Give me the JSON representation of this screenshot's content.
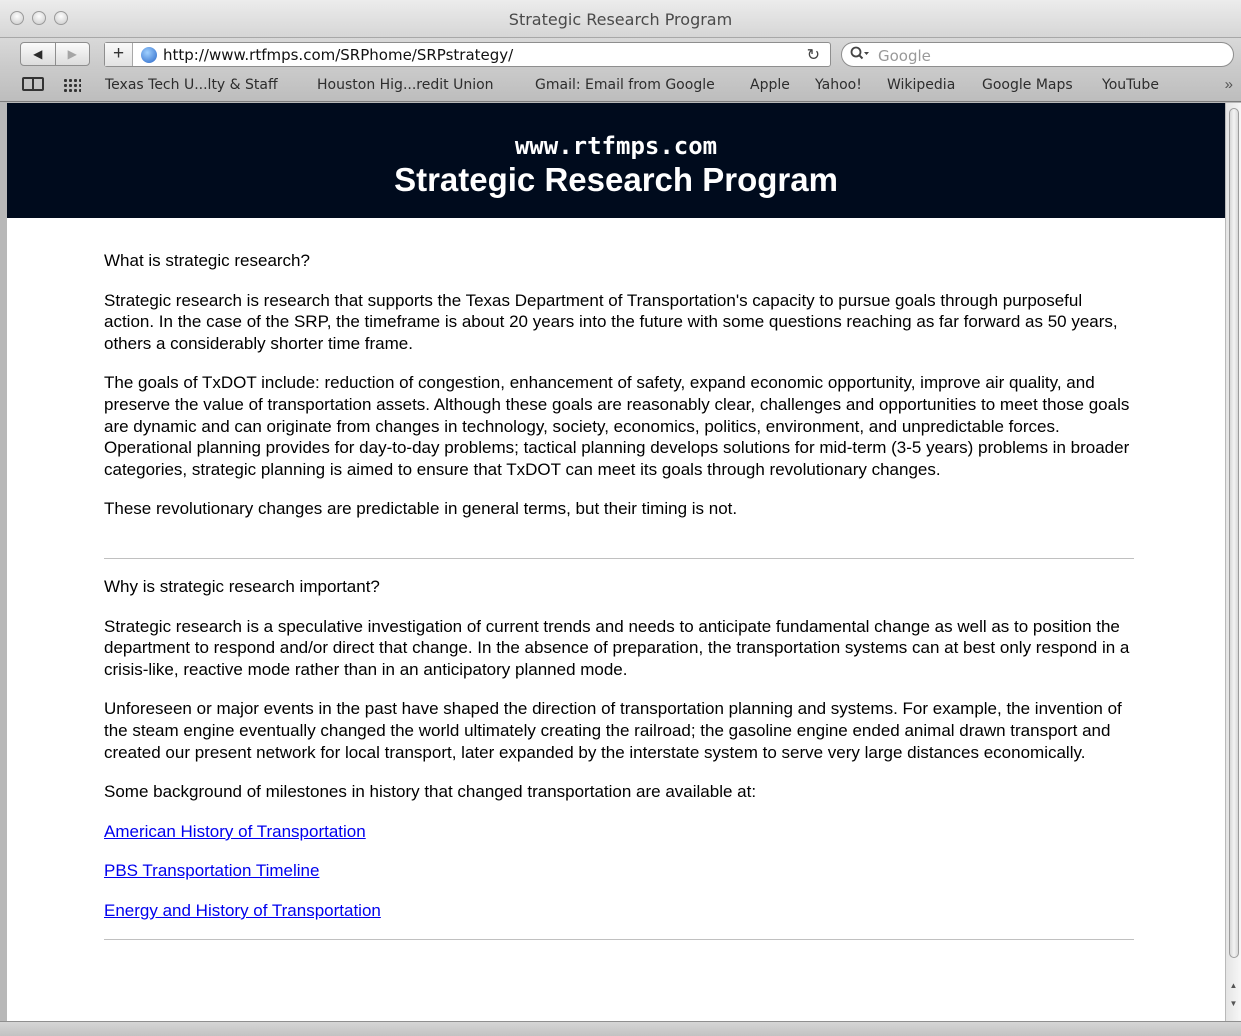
{
  "window": {
    "title": "Strategic Research Program"
  },
  "toolbar": {
    "back": "◀",
    "forward": "▶",
    "add": "+",
    "url": "http://www.rtfmps.com/SRPhome/SRPstrategy/",
    "reload": "↻",
    "search_placeholder": "Google"
  },
  "bookmarks": [
    "Texas Tech U...lty & Staff",
    "Houston Hig...redit Union",
    "Gmail: Email from Google",
    "Apple",
    "Yahoo!",
    "Wikipedia",
    "Google Maps",
    "YouTube"
  ],
  "bookmarks_more": "»",
  "header": {
    "domain": "www.rtfmps.com",
    "title": "Strategic Research Program"
  },
  "section1": {
    "question": "What is strategic research?",
    "paragraphs": [
      "Strategic research is research that supports the Texas Department of Transportation's capacity to pursue goals through purposeful action. In the case of the SRP, the timeframe is about 20 years into the future with some questions reaching as far forward as 50 years, others a considerably shorter time frame.",
      "The goals of TxDOT include: reduction of congestion, enhancement of safety, expand economic opportunity, improve air quality, and preserve the value of transportation assets. Although these goals are reasonably clear, challenges and opportunities to meet those goals are dynamic and can originate from changes in technology, society, economics, politics, environment, and unpredictable forces. Operational planning provides for day-to-day problems; tactical planning develops solutions for mid-term (3-5 years) problems in broader categories, strategic planning is aimed to ensure that TxDOT can meet its goals through revolutionary changes.",
      "These revolutionary changes are predictable in general terms, but their timing is not."
    ]
  },
  "section2": {
    "question": "Why is strategic research important?",
    "paragraphs": [
      "Strategic research is a speculative investigation of current trends and needs to anticipate fundamental change as well as to position the department to respond and/or direct that change. In the absence of preparation, the transportation systems can at best only respond in a crisis-like, reactive mode rather than in an anticipatory planned mode.",
      "Unforeseen or major events in the past have shaped the direction of transportation planning and systems. For example, the invention of the steam engine eventually changed the world ultimately creating the railroad; the gasoline engine ended animal drawn transport and created our present network for local transport, later expanded by the interstate system to serve very large distances economically.",
      "Some background of milestones in history that changed transportation are available at:"
    ],
    "links": [
      "American History of Transportation",
      "PBS Transportation Timeline",
      "Energy and History of Transportation"
    ]
  },
  "colors": {
    "header_bg": "#000b1d",
    "link": "#0000ee"
  }
}
